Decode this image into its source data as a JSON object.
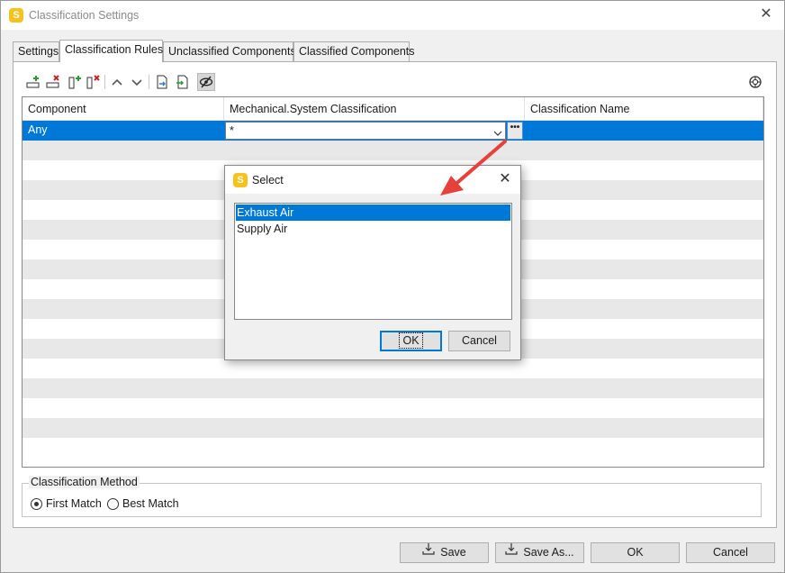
{
  "window": {
    "title": "Classification Settings",
    "app_icon_letter": "S",
    "close_glyph": "✕"
  },
  "tabs": [
    {
      "label": "Settings"
    },
    {
      "label": "Classification Rules"
    },
    {
      "label": "Unclassified Components"
    },
    {
      "label": "Classified Components"
    }
  ],
  "grid": {
    "columns": [
      "Component",
      "Mechanical.System Classification",
      "Classification Name"
    ],
    "selected_row": {
      "component": "Any",
      "classification": "*",
      "name": ""
    },
    "ellipsis": "•••"
  },
  "classification_method": {
    "title": "Classification Method",
    "options": [
      {
        "label": "First Match",
        "selected": true
      },
      {
        "label": "Best Match",
        "selected": false
      }
    ]
  },
  "footer": {
    "save": "Save",
    "save_as": "Save As...",
    "ok": "OK",
    "cancel": "Cancel"
  },
  "dialog": {
    "title": "Select",
    "app_icon_letter": "S",
    "close_glyph": "✕",
    "items": [
      "Exhaust Air",
      "Supply Air"
    ],
    "selected_index": 0,
    "ok": "OK",
    "cancel": "Cancel"
  },
  "colors": {
    "selection": "#0078d7",
    "arrow": "#e8403a",
    "app_icon": "#f7c21b"
  }
}
